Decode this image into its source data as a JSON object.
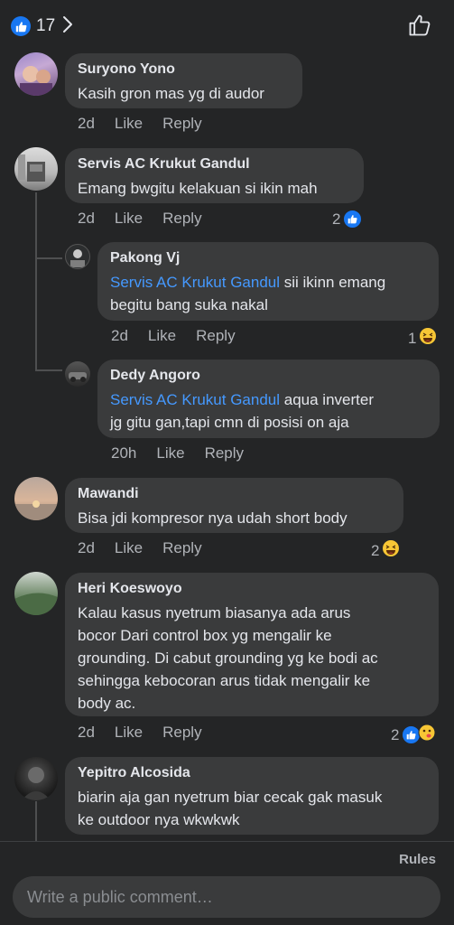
{
  "header": {
    "like_count": "17"
  },
  "comments": [
    {
      "name": "Suryono Yono",
      "text": "Kasih gron mas yg di audor",
      "time": "2d",
      "like": "Like",
      "reply": "Reply"
    },
    {
      "name": "Servis AC Krukut Gandul",
      "text": "Emang bwgitu kelakuan si ikin mah",
      "time": "2d",
      "like": "Like",
      "reply": "Reply",
      "reaction_count": "2",
      "replies": [
        {
          "name": "Pakong Vj",
          "mention": "Servis AC Krukut Gandul",
          "text_line1": " sii ikinn emang",
          "text_line2": "begitu bang suka nakal",
          "time": "2d",
          "like": "Like",
          "reply": "Reply",
          "reaction_count": "1"
        },
        {
          "name": "Dedy Angoro",
          "mention": "Servis AC Krukut Gandul",
          "text_line1": " aqua inverter",
          "text_line2": "jg gitu gan,tapi cmn di posisi on aja",
          "time": "20h",
          "like": "Like",
          "reply": "Reply"
        }
      ]
    },
    {
      "name": "Mawandi",
      "text": "Bisa jdi kompresor nya  udah short body",
      "time": "2d",
      "like": "Like",
      "reply": "Reply",
      "reaction_count": "2"
    },
    {
      "name": "Heri Koeswoyo",
      "lines": [
        "Kalau kasus nyetrum biasanya ada arus",
        "bocor Dari control box yg mengalir ke",
        "grounding. Di cabut grounding yg ke bodi ac",
        "sehingga kebocoran arus tidak mengalir ke",
        "body ac."
      ],
      "time": "2d",
      "like": "Like",
      "reply": "Reply",
      "reaction_count": "2"
    },
    {
      "name": "Yepitro Alcosida",
      "lines": [
        "biarin aja gan nyetrum biar cecak gak masuk",
        "ke outdoor nya wkwkwk"
      ]
    }
  ],
  "footer": {
    "rules": "Rules",
    "composer_placeholder": "Write a public comment…"
  },
  "colors": {
    "background": "#242526",
    "bubble": "#3a3b3c",
    "mention": "#4599ff",
    "like_blue": "#1877f2",
    "haha_yellow": "#f7c635"
  }
}
